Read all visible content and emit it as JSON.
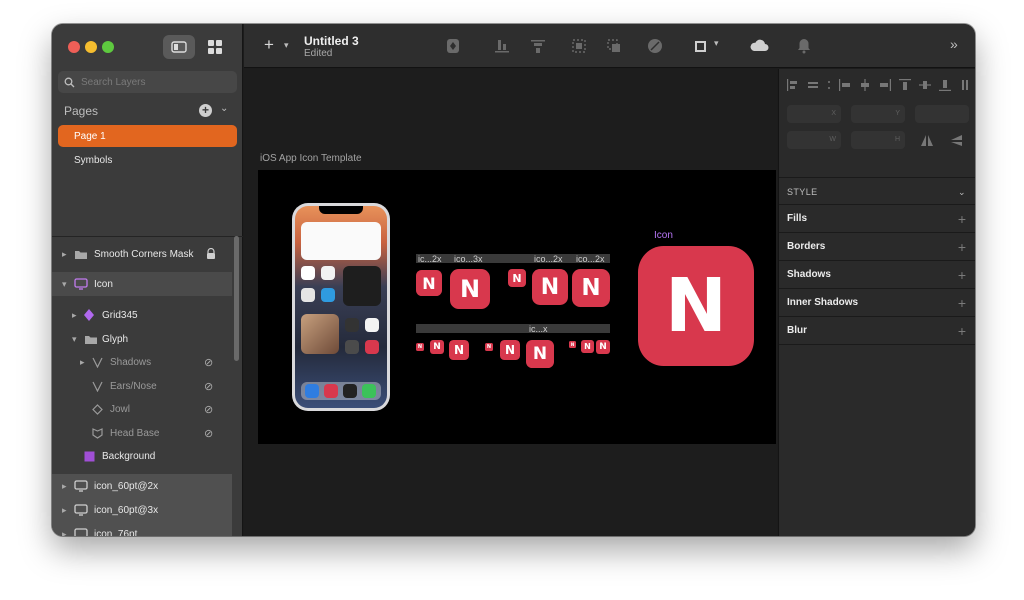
{
  "toolbar": {
    "doc_title": "Untitled 3",
    "doc_status": "Edited"
  },
  "sidebar": {
    "search_placeholder": "Search Layers",
    "pages_label": "Pages",
    "pages": [
      {
        "label": "Page 1",
        "active": true
      },
      {
        "label": "Symbols",
        "active": false
      }
    ],
    "layers": [
      {
        "label": "Smooth Corners Mask"
      },
      {
        "label": "Icon"
      },
      {
        "label": "Grid345"
      },
      {
        "label": "Glyph"
      },
      {
        "label": "Shadows"
      },
      {
        "label": "Ears/Nose"
      },
      {
        "label": "Jowl"
      },
      {
        "label": "Head Base"
      },
      {
        "label": "Background"
      },
      {
        "label": "icon_60pt@2x"
      },
      {
        "label": "icon_60pt@3x"
      },
      {
        "label": "icon_76pt"
      }
    ]
  },
  "canvas": {
    "artboard_label": "iOS App Icon Template",
    "icon_label": "Icon",
    "glyph_letter": "N",
    "small_labels": [
      "ic...2x",
      "ico...3x",
      "ico...2x",
      "ico...2x",
      "ic...x"
    ],
    "brand_color": "#d8384d"
  },
  "inspector": {
    "style_label": "STYLE",
    "sections": [
      "Fills",
      "Borders",
      "Shadows",
      "Inner Shadows",
      "Blur"
    ],
    "field_labels": [
      "X",
      "Y",
      "W",
      "H"
    ]
  }
}
